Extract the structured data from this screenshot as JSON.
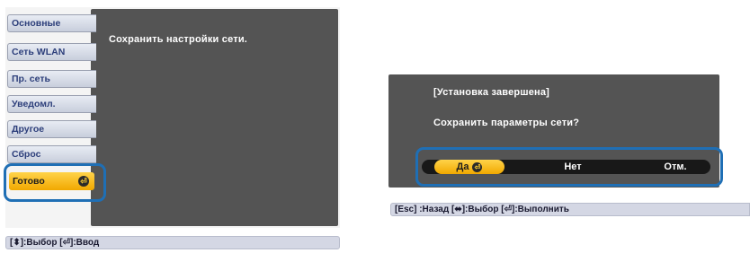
{
  "left_screen": {
    "menu_items": [
      {
        "label": "Основные"
      },
      {
        "label": "Сеть WLAN"
      },
      {
        "label": "Пр. сеть"
      },
      {
        "label": "Уведомл."
      },
      {
        "label": "Другое"
      },
      {
        "label": "Сброс"
      }
    ],
    "selected_item": {
      "label": "Готово",
      "icon": "enter-icon"
    },
    "content_text": "Сохранить настройки сети.",
    "status_bar": "[⬍]:Выбор  [⏎]:Ввод"
  },
  "right_screen": {
    "dialog_title": "[Установка завершена]",
    "dialog_message": "Сохранить параметры сети?",
    "buttons": {
      "yes": "Да",
      "no": "Нет",
      "cancel": "Отм."
    },
    "status_bar": "[Esc] :Назад  [⬌]:Выбор  [⏎]:Выполнить"
  },
  "colors": {
    "panel": "#545454",
    "highlight": "#1f6fb5",
    "selected": "#f1a800",
    "menu_tab": "#d4d8e4"
  }
}
